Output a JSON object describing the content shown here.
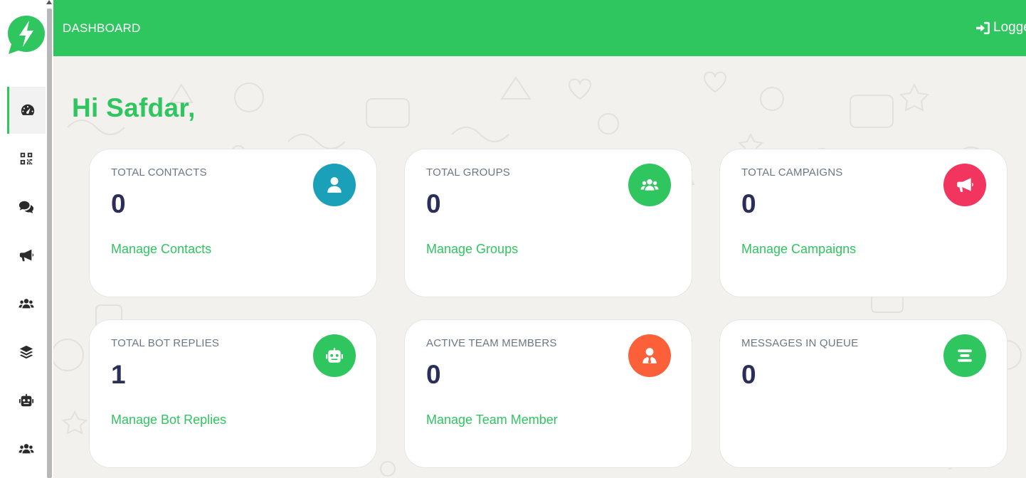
{
  "topbar": {
    "title": "DASHBOARD",
    "logout_label": "Logge"
  },
  "greeting": "Hi Safdar,",
  "sidebar": {
    "items": [
      {
        "icon": "dashboard-gauge-icon",
        "active": true
      },
      {
        "icon": "qrcode-icon",
        "active": false
      },
      {
        "icon": "chat-bubbles-icon",
        "active": false
      },
      {
        "icon": "megaphone-icon",
        "active": false
      },
      {
        "icon": "users-group-icon",
        "active": false
      },
      {
        "icon": "layers-icon",
        "active": false
      },
      {
        "icon": "robot-icon",
        "active": false
      },
      {
        "icon": "users-group-icon",
        "active": false
      }
    ]
  },
  "cards": [
    {
      "label": "TOTAL CONTACTS",
      "value": "0",
      "link": "Manage Contacts",
      "icon": "user-icon",
      "color": "#1aa1b9"
    },
    {
      "label": "TOTAL GROUPS",
      "value": "0",
      "link": "Manage Groups",
      "icon": "users-group-icon",
      "color": "#2fc55f"
    },
    {
      "label": "TOTAL CAMPAIGNS",
      "value": "0",
      "link": "Manage Campaigns",
      "icon": "megaphone-icon",
      "color": "#f1355e"
    },
    {
      "label": "TOTAL BOT REPLIES",
      "value": "1",
      "link": "Manage Bot Replies",
      "icon": "robot-icon",
      "color": "#2fc55f"
    },
    {
      "label": "ACTIVE TEAM MEMBERS",
      "value": "0",
      "link": "Manage Team Member",
      "icon": "user-tie-icon",
      "color": "#fb6038"
    },
    {
      "label": "MESSAGES IN QUEUE",
      "value": "0",
      "link": "",
      "icon": "align-center-icon",
      "color": "#2fc55f"
    }
  ],
  "colors": {
    "brand_green": "#2fc55f",
    "value_text": "#2c2e5a",
    "label_text": "#6b7785",
    "background": "#f3f1ed"
  }
}
